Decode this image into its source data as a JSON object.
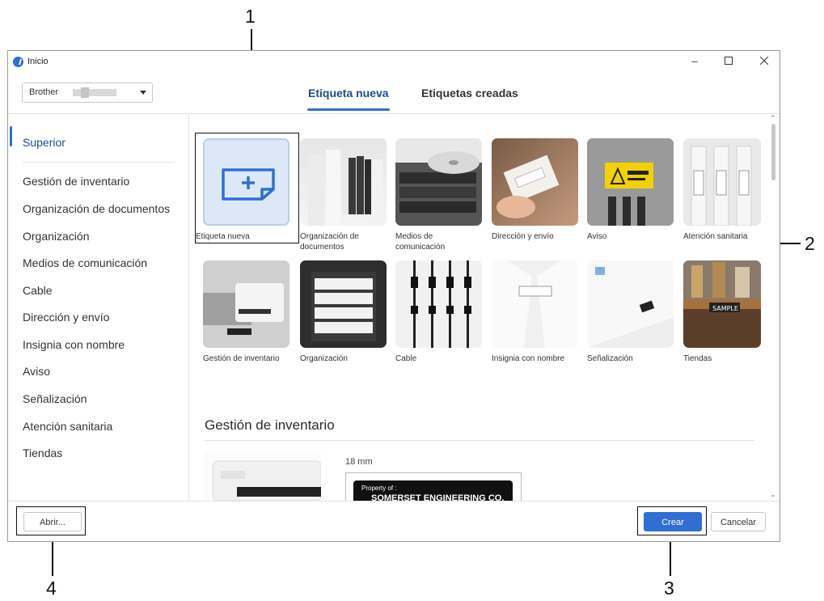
{
  "window": {
    "title": "Inicio"
  },
  "printer": {
    "selected": "Brother"
  },
  "tabs": [
    {
      "label": "Etiqueta nueva",
      "active": true
    },
    {
      "label": "Etiquetas creadas",
      "active": false
    }
  ],
  "sidebar": {
    "items": [
      "Superior",
      "Gestión de inventario",
      "Organización de documentos",
      "Organización",
      "Medios de comunicación",
      "Cable",
      "Dirección y envío",
      "Insignia con nombre",
      "Aviso",
      "Señalización",
      "Atención sanitaria",
      "Tiendas"
    ]
  },
  "tiles": {
    "row1": [
      "Etiqueta nueva",
      "Organización de documentos",
      "Medios de comunicación",
      "Dirección y envío",
      "Aviso",
      "Atención sanitaria"
    ],
    "row2": [
      "Gestión de inventario",
      "Organización",
      "Cable",
      "Insignia con nombre",
      "Señalización",
      "Tiendas"
    ]
  },
  "section": {
    "title": "Gestión de inventario",
    "size": "18 mm",
    "label_line1": "Property of :",
    "label_line2": "SOMERSET ENGINEERING CO."
  },
  "buttons": {
    "open": "Abrir...",
    "create": "Crear",
    "cancel": "Cancelar"
  },
  "callouts": [
    "1",
    "2",
    "3",
    "4"
  ],
  "colors": {
    "accent": "#2f6fd3",
    "active_text": "#1e4b8f"
  }
}
